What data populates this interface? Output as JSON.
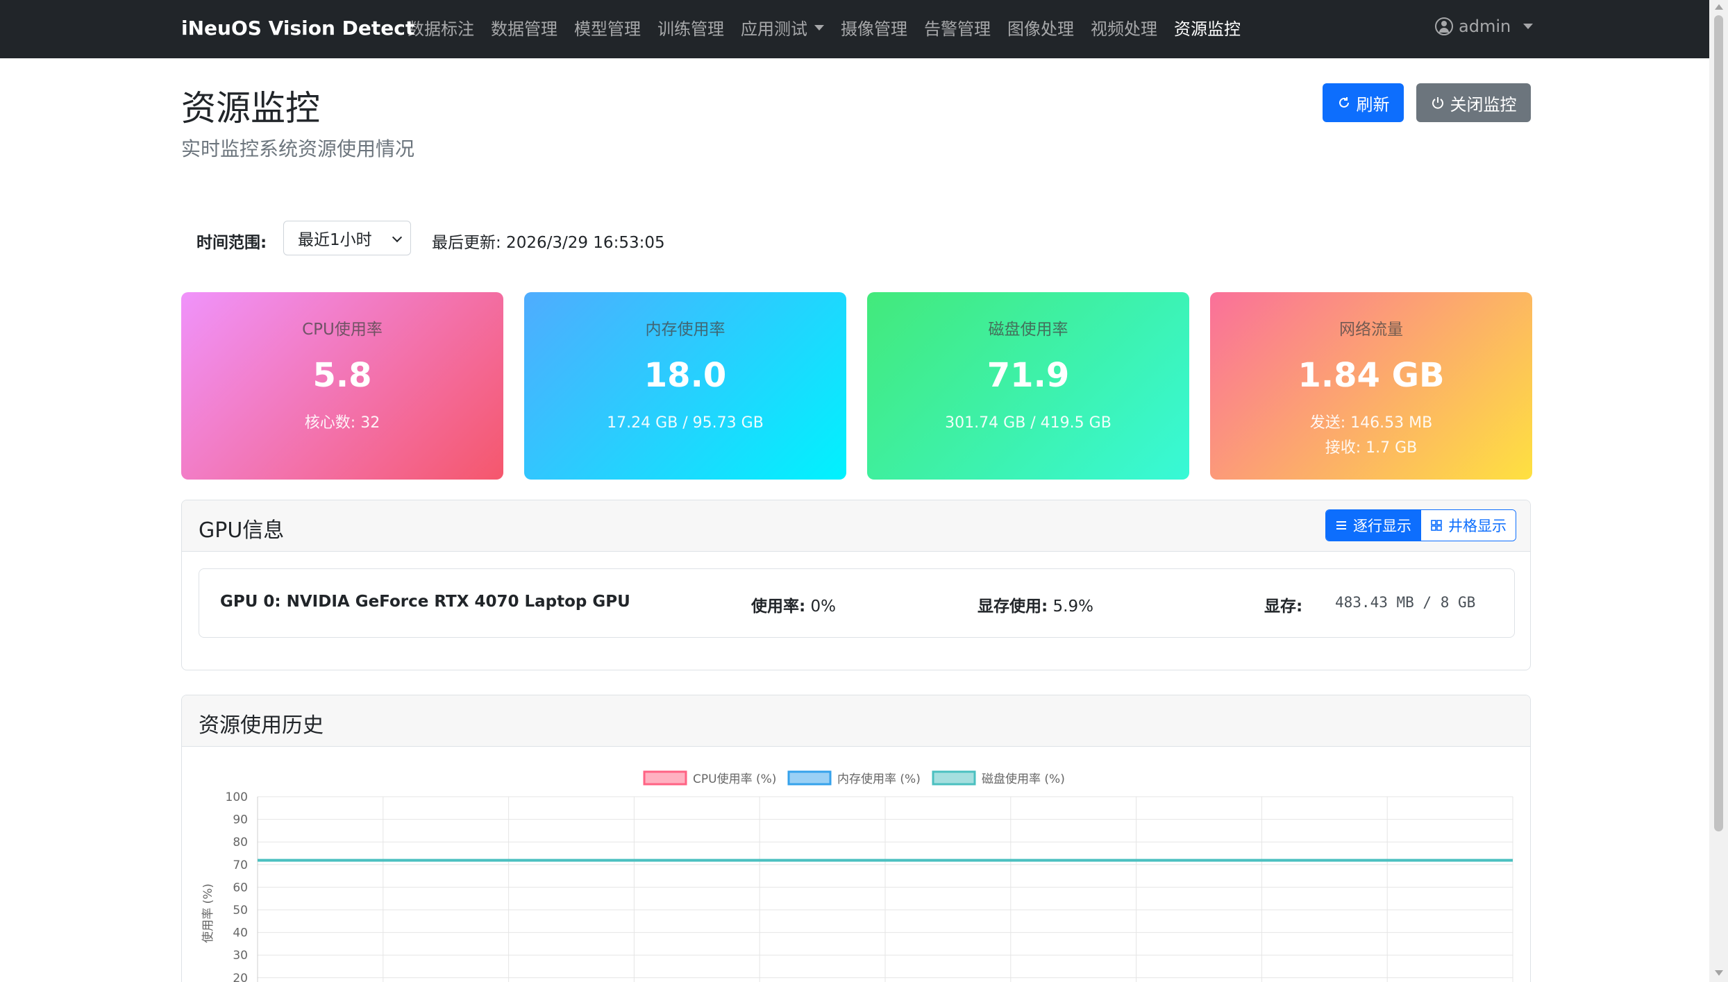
{
  "navbar": {
    "brand": "iNeuOS Vision Detect",
    "items": [
      {
        "label": "数据标注",
        "active": false,
        "dropdown": false
      },
      {
        "label": "数据管理",
        "active": false,
        "dropdown": false
      },
      {
        "label": "模型管理",
        "active": false,
        "dropdown": false
      },
      {
        "label": "训练管理",
        "active": false,
        "dropdown": false
      },
      {
        "label": "应用测试",
        "active": false,
        "dropdown": true
      },
      {
        "label": "摄像管理",
        "active": false,
        "dropdown": false
      },
      {
        "label": "告警管理",
        "active": false,
        "dropdown": false
      },
      {
        "label": "图像处理",
        "active": false,
        "dropdown": false
      },
      {
        "label": "视频处理",
        "active": false,
        "dropdown": false
      },
      {
        "label": "资源监控",
        "active": true,
        "dropdown": false
      }
    ],
    "user": "admin"
  },
  "page": {
    "title": "资源监控",
    "subtitle": "实时监控系统资源使用情况",
    "refresh_label": "刷新",
    "close_label": "关闭监控"
  },
  "filter": {
    "time_label": "时间范围:",
    "time_value": "最近1小时",
    "last_update": "最后更新: 2026/3/29 16:53:05"
  },
  "cards": {
    "cpu": {
      "label": "CPU使用率",
      "value": "5.8",
      "sub": "核心数: 32"
    },
    "memory": {
      "label": "内存使用率",
      "value": "18.0",
      "sub": "17.24 GB / 95.73 GB"
    },
    "disk": {
      "label": "磁盘使用率",
      "value": "71.9",
      "sub": "301.74 GB / 419.5 GB"
    },
    "network": {
      "label": "网络流量",
      "value": "1.84 GB",
      "sub1": "发送: 146.53 MB",
      "sub2": "接收: 1.7 GB"
    }
  },
  "gpu_panel": {
    "title": "GPU信息",
    "toggle_row": "逐行显示",
    "toggle_grid": "井格显示",
    "gpu": {
      "name": "GPU 0: NVIDIA GeForce RTX 4070 Laptop GPU",
      "usage_label": "使用率:",
      "usage_value": "0%",
      "vram_usage_label": "显存使用:",
      "vram_usage_value": "5.9%",
      "vram_label": "显存:",
      "vram_value": "483.43 MB / 8 GB"
    }
  },
  "history_panel": {
    "title": "资源使用历史"
  },
  "colors": {
    "primary": "#0d6efd",
    "secondary": "#6c757d",
    "navbar": "#212529"
  },
  "chart_data": {
    "type": "line",
    "title": "",
    "xlabel": "",
    "ylabel": "使用率 (%)",
    "ylim": [
      20,
      100
    ],
    "yticks": [
      100,
      90,
      80,
      70,
      60,
      50,
      40,
      30,
      20
    ],
    "grid": true,
    "legend_position": "top",
    "series": [
      {
        "name": "CPU使用率 (%)",
        "color": "#ff6384",
        "fill": "#ffb1c1",
        "values": []
      },
      {
        "name": "内存使用率 (%)",
        "color": "#36a2eb",
        "fill": "#9ad0f5",
        "values": []
      },
      {
        "name": "磁盘使用率 (%)",
        "color": "#4bc0c0",
        "fill": "#a5dfdf",
        "values": [
          71.9,
          71.9,
          71.9,
          71.9,
          71.9,
          71.9,
          71.9,
          71.9,
          71.9,
          71.9,
          71.9
        ]
      }
    ]
  }
}
